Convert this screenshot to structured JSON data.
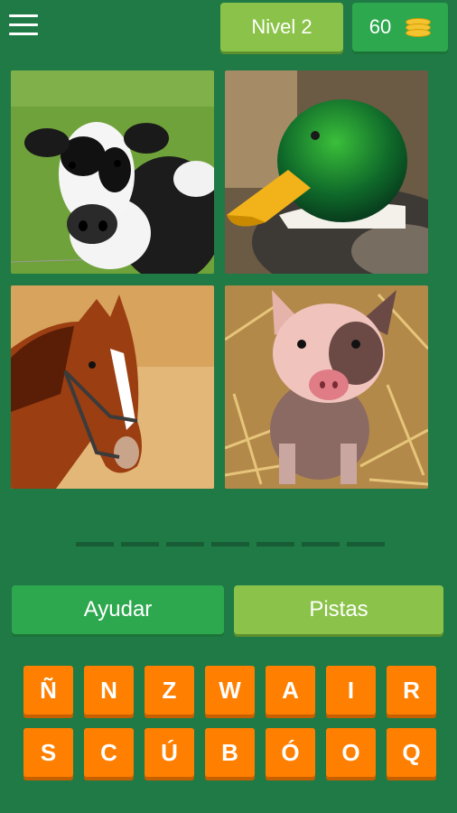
{
  "header": {
    "level_label": "Nivel 2",
    "coins": "60",
    "menu_icon": "hamburger-menu-icon",
    "coin_icon": "coin-stack-icon"
  },
  "images": [
    {
      "name": "cow-image",
      "subject": "cow"
    },
    {
      "name": "duck-image",
      "subject": "duck"
    },
    {
      "name": "horse-image",
      "subject": "horse"
    },
    {
      "name": "pig-image",
      "subject": "pig"
    }
  ],
  "answer": {
    "slot_count": 7
  },
  "buttons": {
    "help_label": "Ayudar",
    "hints_label": "Pistas"
  },
  "keyboard": {
    "row1": [
      "Ñ",
      "N",
      "Z",
      "W",
      "A",
      "I",
      "R"
    ],
    "row2": [
      "S",
      "C",
      "Ú",
      "B",
      "Ó",
      "O",
      "Q"
    ]
  },
  "colors": {
    "background": "#1f7a45",
    "primary_green": "#2ea84f",
    "light_green": "#8bc34a",
    "key_orange": "#ff7f00"
  }
}
